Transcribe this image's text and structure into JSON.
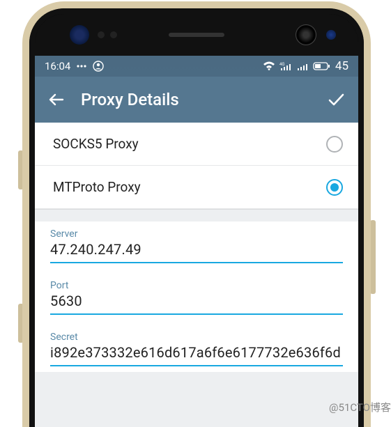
{
  "status_bar": {
    "time": "16:04",
    "battery": "45"
  },
  "app_bar": {
    "title": "Proxy Details"
  },
  "proxy_options": [
    {
      "label": "SOCKS5 Proxy",
      "selected": false
    },
    {
      "label": "MTProto Proxy",
      "selected": true
    }
  ],
  "fields": {
    "server": {
      "label": "Server",
      "value": "47.240.247.49"
    },
    "port": {
      "label": "Port",
      "value": "5630"
    },
    "secret": {
      "label": "Secret",
      "value": "i892e373332e616d617a6f6e6177732e636f6d"
    }
  },
  "watermark": "@51CTO博客"
}
